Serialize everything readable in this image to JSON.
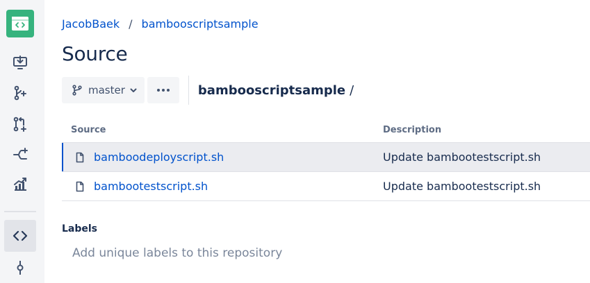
{
  "sidebar": {
    "repo_icon": "code-repo-icon",
    "items": [
      {
        "name": "clone-icon"
      },
      {
        "name": "create-branch-icon"
      },
      {
        "name": "pull-request-icon"
      },
      {
        "name": "pipelines-icon"
      },
      {
        "name": "insights-icon"
      },
      {
        "name": "source-icon",
        "active": true
      },
      {
        "name": "commits-icon"
      }
    ]
  },
  "breadcrumb": {
    "owner": "JacobBaek",
    "separator": "/",
    "repo": "bambooscriptsample"
  },
  "page": {
    "title": "Source"
  },
  "toolbar": {
    "branch": "master",
    "path_repo": "bambooscriptsample",
    "path_slash": "/"
  },
  "table": {
    "headers": {
      "source": "Source",
      "description": "Description"
    },
    "rows": [
      {
        "name": "bamboodeployscript.sh",
        "description": "Update bambootestscript.sh",
        "selected": true
      },
      {
        "name": "bambootestscript.sh",
        "description": "Update bambootestscript.sh",
        "selected": false
      }
    ]
  },
  "labels": {
    "title": "Labels",
    "placeholder": "Add unique labels to this repository"
  },
  "colors": {
    "accent": "#0052cc",
    "repo_avatar": "#36b37e",
    "sidebar_bg": "#f4f5f7",
    "selected_row": "#ebecf0"
  }
}
